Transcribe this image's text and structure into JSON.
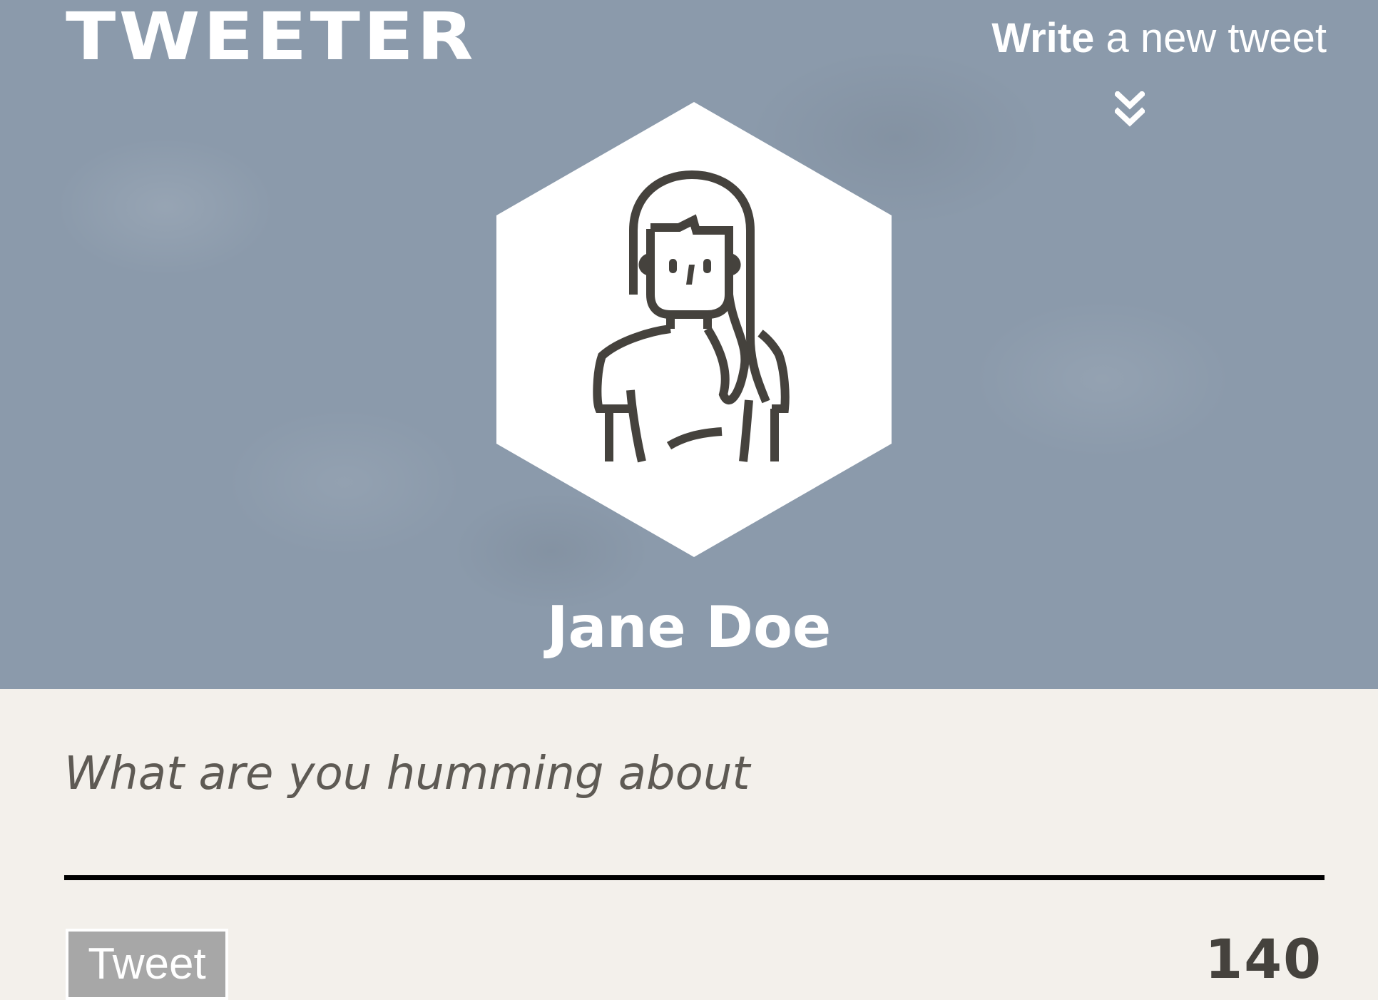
{
  "header": {
    "logo": "TWEETER",
    "write_strong": "Write",
    "write_rest": " a new tweet"
  },
  "profile": {
    "name": "Jane Doe",
    "avatar_icon": "woman-avatar-icon"
  },
  "compose": {
    "placeholder": "What are you humming about",
    "value": "",
    "tweet_button_label": "Tweet",
    "char_count": "140"
  },
  "colors": {
    "hero_background": "#8b9aab",
    "compose_background": "#f3f0eb",
    "button_background": "#a7a7a7",
    "counter_text": "#45423d"
  }
}
